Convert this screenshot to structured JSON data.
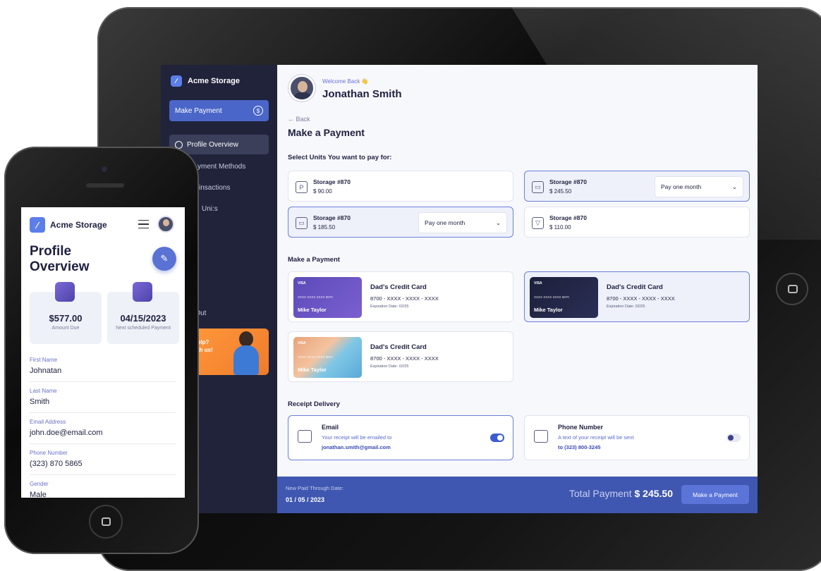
{
  "tablet": {
    "brand": "Acme Storage",
    "make_payment_btn": "Make Payment",
    "nav": [
      "Profile Overview",
      "yment Methods",
      "insactions",
      "Uni:s",
      "g Out"
    ],
    "help_text": "elp?\nth us!",
    "welcome": "Welcome Back 👋",
    "user_name": "Jonathan Smith",
    "back": "← Back",
    "page_title": "Make a Payment",
    "units_label": "Select Units You want to pay for:",
    "units": [
      {
        "name": "Storage #870",
        "price": "$ 90.00",
        "icon": "P",
        "selected": false,
        "select": ""
      },
      {
        "name": "Storage #870",
        "price": "$ 245.50",
        "icon": "▭",
        "selected": true,
        "select": "Pay one month"
      },
      {
        "name": "Storage #870",
        "price": "$ 185.50",
        "icon": "▭",
        "selected": true,
        "select": "Pay one month"
      },
      {
        "name": "Storage #870",
        "price": "$ 110.00",
        "icon": "▽",
        "selected": false,
        "select": ""
      }
    ],
    "payment_label": "Make a Payment",
    "cards": [
      {
        "title": "Dad's Credit Card",
        "number": "8700 - XXXX - XXXX - XXXX",
        "exp": "Expiration Date: 02/25",
        "holder": "Mike Taylor",
        "card_num": "XXXX XXXX XXXX 9870",
        "brand": "VISA"
      },
      {
        "title": "Dad's Credit Card",
        "number": "8700 - XXXX - XXXX - XXXX",
        "exp": "Expiration Date: 02/25",
        "holder": "Mike Taylor",
        "card_num": "XXXX XXXX XXXX 9870",
        "brand": "VISA"
      },
      {
        "title": "Dad's Credit Card",
        "number": "8700 - XXXX - XXXX - XXXX",
        "exp": "Expiration Date: 02/25",
        "holder": "Mike Taylor",
        "card_num": "XXXX XXXX XXXX 9870",
        "brand": "VISA"
      }
    ],
    "receipt_label": "Receipt Delivery",
    "receipt": {
      "email_title": "Email",
      "email_text": "Your receipt will be emailed to",
      "email_value": "jonathan.smith@gmail.com",
      "phone_title": "Phone Number",
      "phone_text": "A text of your receipt will be sent",
      "phone_value": "to (323) 800-3245"
    },
    "footer": {
      "paid_label": "New Paid Through Date:",
      "paid_date": "01 / 05 / 2023",
      "total_label": "Total Payment",
      "total_value": "$ 245.50",
      "pay_btn": "Make a Payment"
    }
  },
  "phone": {
    "brand": "Acme Storage",
    "title": "Profile Overview",
    "amount_value": "$577.00",
    "amount_label": "Amount Due",
    "next_value": "04/15/2023",
    "next_label": "Next scheduled Payment",
    "fields": [
      {
        "label": "First Name",
        "value": "Johnatan"
      },
      {
        "label": "Last Name",
        "value": "Smith"
      },
      {
        "label": "Email Address",
        "value": "john.doe@email.com"
      },
      {
        "label": "Phone Number",
        "value": "(323) 870 5865"
      },
      {
        "label": "Gender",
        "value": "Male"
      }
    ]
  },
  "colors": {
    "sidebar": "#20233a",
    "accent": "#4a66c8",
    "footer": "#3f57b0"
  }
}
